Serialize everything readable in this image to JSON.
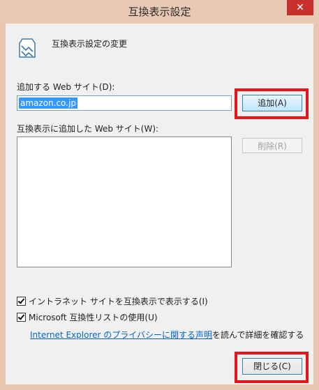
{
  "window": {
    "title": "互換表示設定",
    "close_glyph": "✕"
  },
  "header": {
    "icon": "compat-view-icon",
    "text": "互換表示設定の変更"
  },
  "add_site": {
    "label": "追加する Web サイト(D):",
    "value": "amazon.co.jp",
    "add_button": "追加(A)"
  },
  "site_list": {
    "label": "互換表示に追加した Web サイト(W):",
    "items": [],
    "remove_button": "削除(R)"
  },
  "options": {
    "intranet": {
      "label": "イントラネット サイトを互換表示で表示する(I)",
      "checked": true
    },
    "ms_list": {
      "label": "Microsoft 互換性リストの使用(U)",
      "checked": true
    }
  },
  "privacy": {
    "link_text": "Internet Explorer のプライバシーに関する声明",
    "suffix": "を読んで詳細を確認する"
  },
  "footer": {
    "close_button": "閉じる(C)"
  },
  "colors": {
    "highlight": "#e8141c",
    "selection": "#3399ff",
    "link": "#0066cc"
  }
}
